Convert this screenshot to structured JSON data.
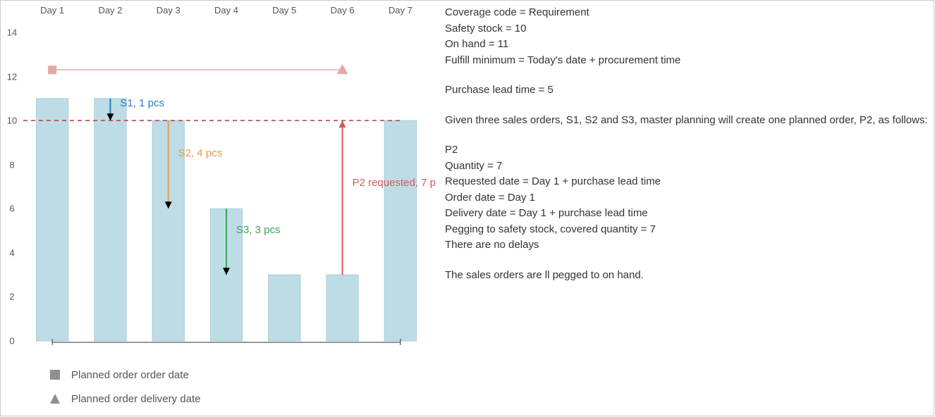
{
  "chart_data": {
    "type": "bar",
    "categories": [
      "Day 1",
      "Day 2",
      "Day 3",
      "Day 4",
      "Day 5",
      "Day 6",
      "Day 7"
    ],
    "values": [
      11,
      11,
      10,
      6,
      3,
      3,
      10
    ],
    "ylim": [
      0,
      14
    ],
    "yticks": [
      0,
      2,
      4,
      6,
      8,
      10,
      12,
      14
    ],
    "safety_stock_line": 10,
    "lead_time_span": {
      "from_day": 1,
      "to_day": 6
    },
    "arrows": [
      {
        "id": "S1",
        "day": 2,
        "from": 11,
        "to": 10,
        "label": "S1, 1 pcs",
        "color": "blue"
      },
      {
        "id": "S2",
        "day": 3,
        "from": 10,
        "to": 6,
        "label": "S2, 4 pcs",
        "color": "orange"
      },
      {
        "id": "S3",
        "day": 4,
        "from": 6,
        "to": 3,
        "label": "S3, 3 pcs",
        "color": "green"
      },
      {
        "id": "P2",
        "day": 6,
        "from": 3,
        "to": 10,
        "label": "P2 requested, 7 p",
        "color": "red"
      }
    ]
  },
  "legend": {
    "order_date": "Planned order order date",
    "delivery_date": "Planned order delivery date"
  },
  "description": {
    "coverage": "Coverage code = Requirement",
    "safety_stock": "Safety stock = 10",
    "on_hand": "On hand = 11",
    "fulfill_min": "Fulfill minimum = Today's date + procurement time",
    "lead_time": "Purchase lead time = 5",
    "intro": "Given three sales orders, S1, S2 and S3, master planning will create one planned order, P2, as follows:",
    "p2_header": "P2",
    "p2_quantity": "Quantity = 7",
    "p2_requested": "Requested date = Day 1 + purchase lead time",
    "p2_orderdate": "Order date = Day 1",
    "p2_delivery": "Delivery date = Day 1 + purchase lead time",
    "p2_pegging": "Pegging to safety stock, covered quantity = 7",
    "p2_nodelays": "There are no delays",
    "pegging_note": " The sales orders are ll pegged to on hand."
  },
  "colors": {
    "bar": "#bedce6",
    "bar_stroke": "#a9cdd9",
    "safety_line": "#b33b3b",
    "lead_span": "#e6a8a8",
    "blue": "#2e78c4",
    "orange": "#e89a4a",
    "green": "#3fa05a",
    "red": "#d05a5a",
    "axis": "#555"
  }
}
